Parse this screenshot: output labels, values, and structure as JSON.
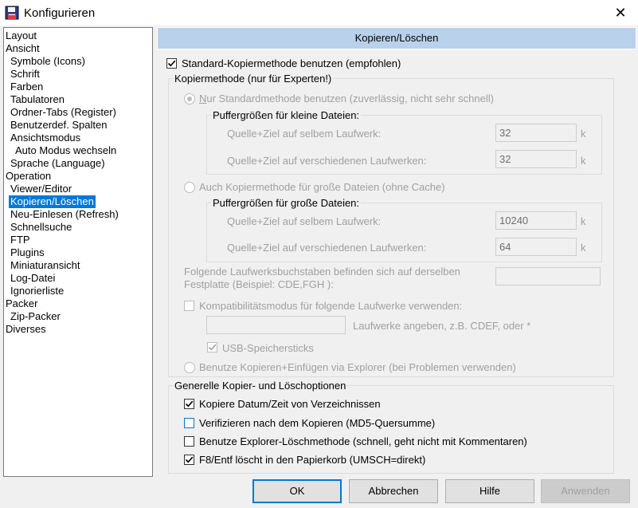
{
  "window": {
    "title": "Konfigurieren"
  },
  "tree": {
    "items": [
      {
        "label": "Layout",
        "indent": 0
      },
      {
        "label": "Ansicht",
        "indent": 0
      },
      {
        "label": "Symbole (Icons)",
        "indent": 1
      },
      {
        "label": "Schrift",
        "indent": 1
      },
      {
        "label": "Farben",
        "indent": 1
      },
      {
        "label": "Tabulatoren",
        "indent": 1
      },
      {
        "label": "Ordner-Tabs (Register)",
        "indent": 1
      },
      {
        "label": "Benutzerdef. Spalten",
        "indent": 1
      },
      {
        "label": "Ansichtsmodus",
        "indent": 1
      },
      {
        "label": "Auto Modus wechseln",
        "indent": 2
      },
      {
        "label": "Sprache (Language)",
        "indent": 1
      },
      {
        "label": "Operation",
        "indent": 0
      },
      {
        "label": "Viewer/Editor",
        "indent": 1
      },
      {
        "label": "Kopieren/Löschen",
        "indent": 1,
        "selected": true
      },
      {
        "label": "Neu-Einlesen (Refresh)",
        "indent": 1
      },
      {
        "label": "Schnellsuche",
        "indent": 1
      },
      {
        "label": "FTP",
        "indent": 1
      },
      {
        "label": "Plugins",
        "indent": 1
      },
      {
        "label": "Miniaturansicht",
        "indent": 1
      },
      {
        "label": "Log-Datei",
        "indent": 1
      },
      {
        "label": "Ignorierliste",
        "indent": 1
      },
      {
        "label": "Packer",
        "indent": 0
      },
      {
        "label": "Zip-Packer",
        "indent": 1
      },
      {
        "label": "Diverses",
        "indent": 0
      }
    ]
  },
  "page": {
    "header": "Kopieren/Löschen",
    "standard_method": {
      "label": "Standard-Kopiermethode benutzen (empfohlen)",
      "checked": true
    },
    "expert_group": {
      "title": "Kopiermethode (nur für Experten!)",
      "radio_standard": {
        "label": "Nur Standardmethode benutzen (zuverlässig, nicht sehr schnell)",
        "selected": true
      },
      "small_files": {
        "title": "Puffergrößen für kleine Dateien:",
        "same_drive_label": "Quelle+Ziel auf selbem Laufwerk:",
        "same_drive_value": "32",
        "diff_drive_label": "Quelle+Ziel auf verschiedenen Laufwerken:",
        "diff_drive_value": "32",
        "unit": "k"
      },
      "radio_own": {
        "label": "Auch Kopiermethode für große Dateien (ohne Cache)",
        "selected": false
      },
      "large_files": {
        "title": "Puffergrößen für große Dateien:",
        "same_drive_label": "Quelle+Ziel auf selbem Laufwerk:",
        "same_drive_value": "10240",
        "diff_drive_label": "Quelle+Ziel auf verschiedenen Laufwerken:",
        "diff_drive_value": "64",
        "unit": "k"
      },
      "same_disk_note_line1": "Folgende Laufwerksbuchstaben befinden sich auf derselben",
      "same_disk_note_line2": "Festplatte (Beispiel: CDE,FGH ):",
      "same_disk_value": "",
      "compat_mode": {
        "label": "Kompatibilitätsmodus für folgende Laufwerke verwenden:",
        "checked": false
      },
      "compat_drives_value": "",
      "compat_drives_hint": "Laufwerke angeben, z.B. CDEF, oder *",
      "usb_sticks": {
        "label": "USB-Speichersticks",
        "checked": true
      },
      "radio_explorer": {
        "label": "Benutze Kopieren+Einfügen via Explorer (bei Problemen verwenden)",
        "selected": false
      }
    },
    "general_group": {
      "title": "Generelle Kopier- und Löschoptionen",
      "copy_datetime": {
        "label": "Kopiere Datum/Zeit von Verzeichnissen",
        "checked": true
      },
      "verify": {
        "label": "Verifizieren nach dem Kopieren (MD5-Quersumme)",
        "checked": false
      },
      "explorer_delete": {
        "label": "Benutze Explorer-Löschmethode (schnell, geht nicht mit Kommentaren)",
        "checked": false
      },
      "f8_recycle": {
        "label": "F8/Entf löscht in den Papierkorb (UMSCH=direkt)",
        "checked": true
      }
    }
  },
  "buttons": {
    "ok": "OK",
    "cancel": "Abbrechen",
    "help": "Hilfe",
    "apply": "Anwenden"
  },
  "colors": {
    "selection": "#0078d7",
    "header_bar": "#b9d1ea"
  }
}
